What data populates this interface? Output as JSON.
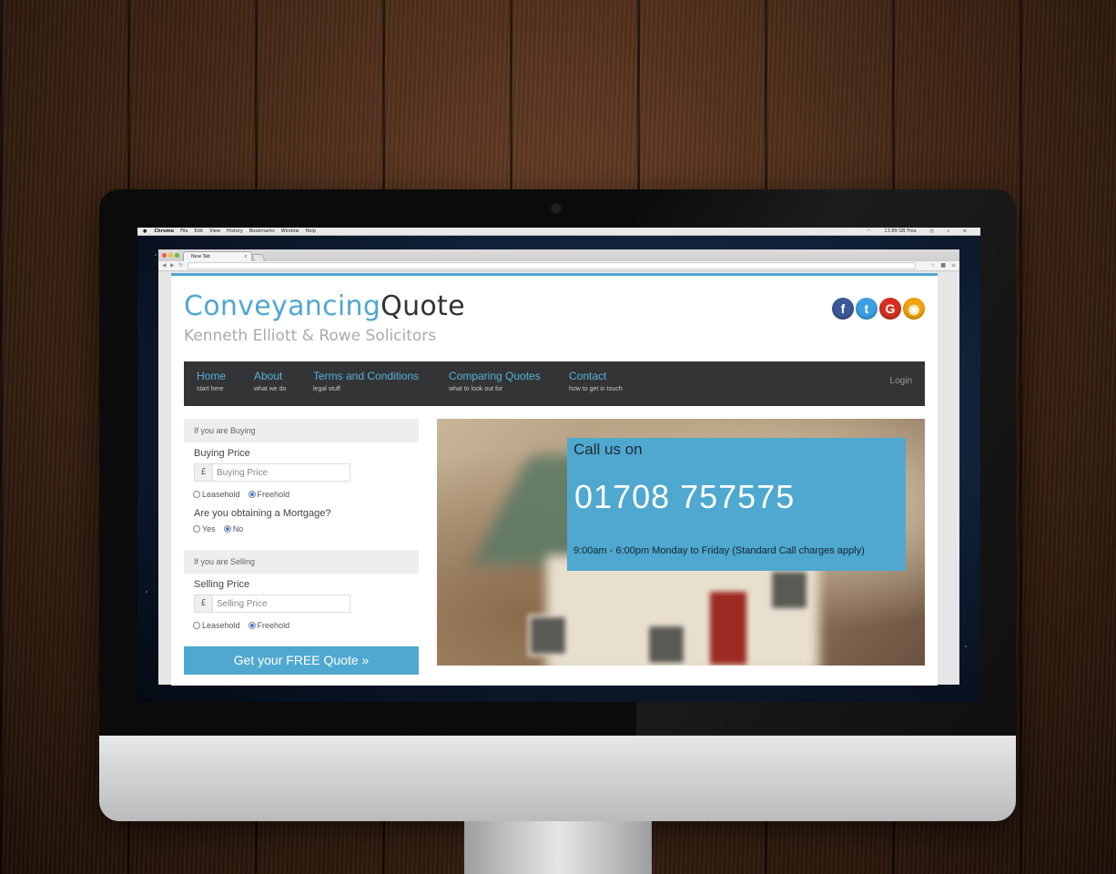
{
  "mac_menubar": {
    "apple": "",
    "app": "Chrome",
    "items": [
      "File",
      "Edit",
      "View",
      "History",
      "Bookmarks",
      "Window",
      "Help"
    ],
    "status": "13.89 GB Free"
  },
  "browser": {
    "tab_title": "New Tab",
    "tab_close": "×"
  },
  "site": {
    "logo_part1": "Conveyancing",
    "logo_part2": "Quote",
    "subtitle": "Kenneth Elliott & Rowe Solicitors",
    "social": [
      {
        "icon": "facebook-icon",
        "glyph": "f",
        "color": "#3b5998"
      },
      {
        "icon": "twitter-icon",
        "glyph": "t",
        "color": "#3aa0e3"
      },
      {
        "icon": "google-plus-icon",
        "glyph": "G",
        "color": "#d4301f"
      },
      {
        "icon": "rss-icon",
        "glyph": "◉",
        "color": "#f0a30a"
      }
    ]
  },
  "nav": {
    "items": [
      {
        "label": "Home",
        "sub": "start here"
      },
      {
        "label": "About",
        "sub": "what we do"
      },
      {
        "label": "Terms and Conditions",
        "sub": "legal stuff"
      },
      {
        "label": "Comparing Quotes",
        "sub": "what to look out for"
      },
      {
        "label": "Contact",
        "sub": "how to get in touch"
      }
    ],
    "login": "Login"
  },
  "form": {
    "buying_header": "If you are Buying",
    "buying_price_label": "Buying Price",
    "currency": "£",
    "buying_placeholder": "Buying Price",
    "leasehold": "Leasehold",
    "freehold": "Freehold",
    "mortgage_label": "Are you obtaining a Mortgage?",
    "yes": "Yes",
    "no": "No",
    "selling_header": "If you are Selling",
    "selling_price_label": "Selling Price",
    "selling_placeholder": "Selling Price",
    "submit": "Get your FREE Quote »"
  },
  "callout": {
    "title": "Call us on",
    "phone": "01708 757575",
    "hours": "9:00am - 6:00pm Monday to Friday (Standard Call charges apply)"
  },
  "colors": {
    "accent": "#4fa8cf",
    "nav_bg": "#333435"
  }
}
